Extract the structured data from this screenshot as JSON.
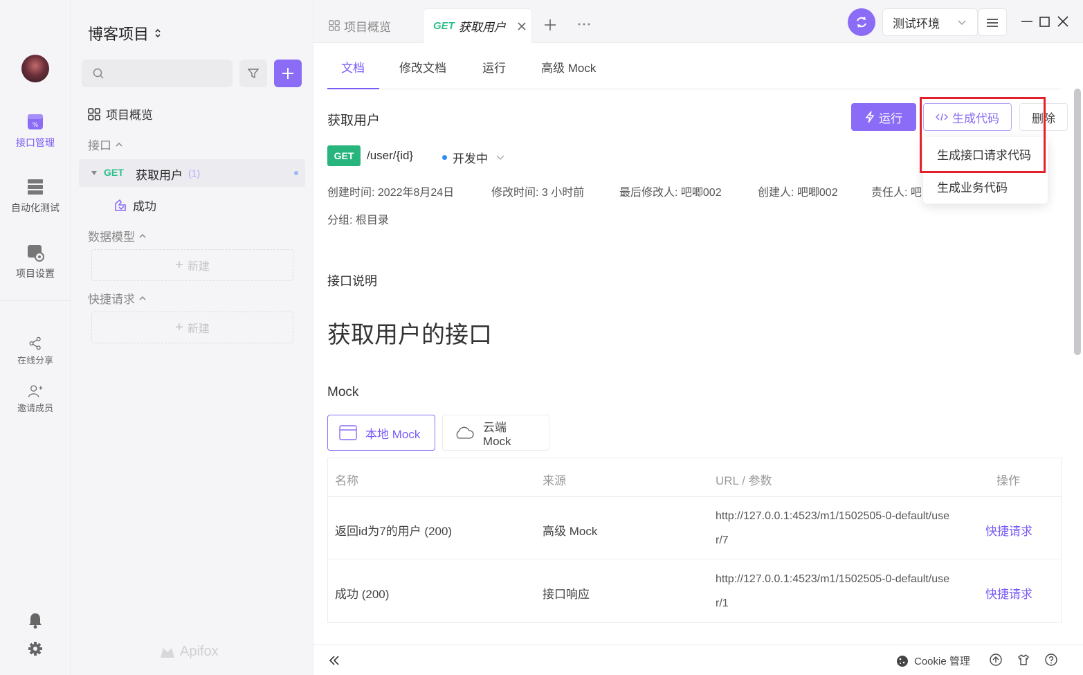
{
  "rail": {
    "items": [
      {
        "label": "接口管理",
        "icon": "api-management-icon"
      },
      {
        "label": "自动化测试",
        "icon": "automation-test-icon"
      },
      {
        "label": "项目设置",
        "icon": "project-settings-icon"
      },
      {
        "label": "在线分享",
        "icon": "share-icon"
      },
      {
        "label": "邀请成员",
        "icon": "invite-member-icon"
      }
    ]
  },
  "side": {
    "project_title": "博客项目",
    "overview_label": "项目概览",
    "api_group": "接口",
    "selected_api": {
      "method": "GET",
      "name": "获取用户",
      "count": "(1)"
    },
    "sub_item": "成功",
    "model_group": "数据模型",
    "quick_group": "快捷请求",
    "new_label": "新建",
    "brand": "Apifox"
  },
  "topbar": {
    "tabs": [
      {
        "label": "项目概览"
      },
      {
        "method": "GET",
        "label": "获取用户"
      }
    ],
    "env": "测试环境"
  },
  "main": {
    "subtabs": [
      "文档",
      "修改文档",
      "运行",
      "高级 Mock"
    ],
    "api_title": "获取用户",
    "run_label": "运行",
    "gen_code_label": "生成代码",
    "delete_label": "删除",
    "dropdown": [
      "生成接口请求代码",
      "生成业务代码"
    ],
    "method": "GET",
    "path": "/user/{id}",
    "status": "开发中",
    "meta": {
      "created": "创建时间: 2022年8月24日",
      "modified": "修改时间: 3 小时前",
      "last_modifier": "最后修改人: 吧唧002",
      "creator": "创建人: 吧唧002",
      "owner": "责任人: 吧"
    },
    "group": "分组: 根目录",
    "desc_label": "接口说明",
    "desc_text": "获取用户的接口",
    "mock_label": "Mock",
    "mock_local": "本地 Mock",
    "mock_cloud": "云端 Mock",
    "table": {
      "headers": [
        "名称",
        "来源",
        "URL / 参数",
        "操作"
      ],
      "rows": [
        {
          "name": "返回id为7的用户 (200)",
          "source": "高级 Mock",
          "url": "http://127.0.0.1:4523/m1/1502505-0-default/user/7",
          "action": "快捷请求"
        },
        {
          "name": "成功 (200)",
          "source": "接口响应",
          "url": "http://127.0.0.1:4523/m1/1502505-0-default/user/1",
          "action": "快捷请求"
        }
      ]
    }
  },
  "bottombar": {
    "cookie_label": "Cookie 管理"
  },
  "colors": {
    "accent": "#8b6cf6",
    "get_green": "#27b57d",
    "highlight_red": "#e4202d"
  }
}
